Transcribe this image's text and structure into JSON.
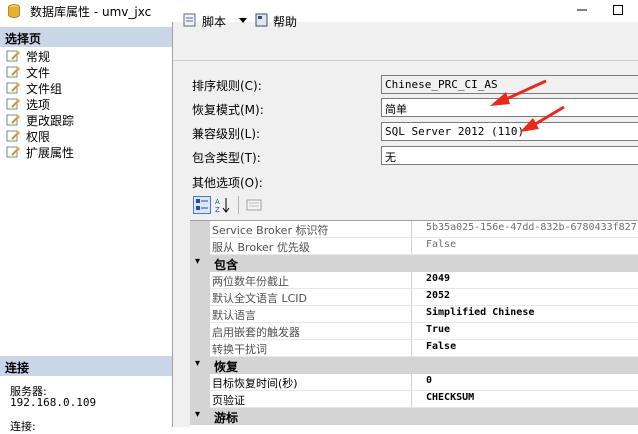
{
  "window": {
    "title": "数据库属性 - umv_jxc"
  },
  "left_pane": {
    "header": "选择页",
    "items": [
      {
        "label": "常规",
        "icon": "wrench-page-icon"
      },
      {
        "label": "文件",
        "icon": "wrench-page-icon"
      },
      {
        "label": "文件组",
        "icon": "wrench-page-icon"
      },
      {
        "label": "选项",
        "icon": "wrench-page-icon"
      },
      {
        "label": "更改跟踪",
        "icon": "wrench-page-icon"
      },
      {
        "label": "权限",
        "icon": "wrench-page-icon"
      },
      {
        "label": "扩展属性",
        "icon": "wrench-page-icon"
      }
    ],
    "connection": {
      "header": "连接",
      "server_label": "服务器:",
      "server_value": "192.168.0.109",
      "connection_label": "连接:"
    }
  },
  "toolbar": {
    "script_label": "脚本",
    "help_label": "帮助"
  },
  "form": {
    "collation": {
      "label": "排序规则(C):",
      "value": "Chinese_PRC_CI_AS"
    },
    "recovery_model": {
      "label": "恢复模式(M):",
      "value": "简单"
    },
    "compatibility_level": {
      "label": "兼容级别(L):",
      "value": "SQL Server 2012 (110)"
    },
    "containment_type": {
      "label": "包含类型(T):",
      "value": "无"
    },
    "other_options_label": "其他选项(O):"
  },
  "grid": {
    "rows": [
      {
        "kind": "prop",
        "name": "Service Broker 标识符",
        "value": "5b35a025-156e-47dd-832b-6780433f827"
      },
      {
        "kind": "prop",
        "name": "服从 Broker 优先级",
        "value": "False"
      },
      {
        "kind": "cat",
        "name": "包含",
        "toggle": "▾"
      },
      {
        "kind": "prop",
        "name": "两位数年份截止",
        "value": "2049",
        "style": "bold"
      },
      {
        "kind": "prop",
        "name": "默认全文语言 LCID",
        "value": "2052",
        "style": "bold"
      },
      {
        "kind": "prop",
        "name": "默认语言",
        "value": "Simplified Chinese",
        "style": "bold"
      },
      {
        "kind": "prop",
        "name": "启用嵌套的触发器",
        "value": "True",
        "style": "bold"
      },
      {
        "kind": "prop",
        "name": "转换干扰词",
        "value": "False",
        "style": "bold"
      },
      {
        "kind": "cat",
        "name": "恢复",
        "toggle": "▾"
      },
      {
        "kind": "prop",
        "name": "目标恢复时间(秒)",
        "value": "0",
        "style": "dark"
      },
      {
        "kind": "prop",
        "name": "页验证",
        "value": "CHECKSUM",
        "style": "dark"
      },
      {
        "kind": "cat",
        "name": "游标",
        "toggle": "▾"
      }
    ]
  },
  "colors": {
    "header_bg": "#c8d6e8",
    "arrow_red": "#e8291c",
    "grid_gutter": "#d4d4d4"
  }
}
